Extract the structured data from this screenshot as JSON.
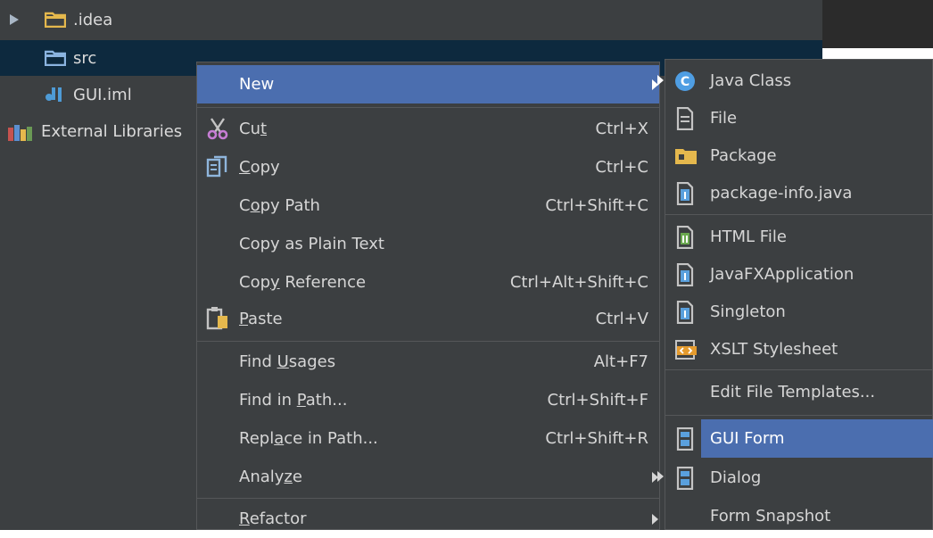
{
  "tree": {
    "items": [
      {
        "label": ".idea",
        "icon": "folder-icon"
      },
      {
        "label": "src",
        "icon": "source-folder-icon"
      },
      {
        "label": "GUI.iml",
        "icon": "iml-file-icon"
      },
      {
        "label": "External Libraries",
        "icon": "libraries-icon"
      }
    ]
  },
  "context_menu": {
    "items": [
      {
        "pre": "",
        "u": "",
        "post": "New",
        "shortcut": ""
      },
      {
        "pre": "Cu",
        "u": "t",
        "post": "",
        "shortcut": "Ctrl+X"
      },
      {
        "pre": "",
        "u": "C",
        "post": "opy",
        "shortcut": "Ctrl+C"
      },
      {
        "pre": "C",
        "u": "o",
        "post": "py Path",
        "shortcut": "Ctrl+Shift+C"
      },
      {
        "pre": "Copy as Plain Text",
        "u": "",
        "post": "",
        "shortcut": ""
      },
      {
        "pre": "Cop",
        "u": "y",
        "post": " Reference",
        "shortcut": "Ctrl+Alt+Shift+C"
      },
      {
        "pre": "",
        "u": "P",
        "post": "aste",
        "shortcut": "Ctrl+V"
      },
      {
        "pre": "Find ",
        "u": "U",
        "post": "sages",
        "shortcut": "Alt+F7"
      },
      {
        "pre": "Find in ",
        "u": "P",
        "post": "ath...",
        "shortcut": "Ctrl+Shift+F"
      },
      {
        "pre": "Repl",
        "u": "a",
        "post": "ce in Path...",
        "shortcut": "Ctrl+Shift+R"
      },
      {
        "pre": "Analy",
        "u": "z",
        "post": "e",
        "shortcut": ""
      },
      {
        "pre": "",
        "u": "R",
        "post": "efactor",
        "shortcut": ""
      }
    ]
  },
  "new_submenu": {
    "items": [
      {
        "label": "Java Class",
        "icon": "java-class-icon"
      },
      {
        "label": "File",
        "icon": "file-icon"
      },
      {
        "label": "Package",
        "icon": "package-icon"
      },
      {
        "label": "package-info.java",
        "icon": "java-file-icon"
      },
      {
        "label": "HTML File",
        "icon": "html-file-icon"
      },
      {
        "label": "JavaFXApplication",
        "icon": "java-file-icon"
      },
      {
        "label": "Singleton",
        "icon": "java-file-icon"
      },
      {
        "label": "XSLT Stylesheet",
        "icon": "xslt-icon"
      },
      {
        "label": "Edit File Templates...",
        "icon": ""
      },
      {
        "label": "GUI Form",
        "icon": "gui-form-icon"
      },
      {
        "label": "Dialog",
        "icon": "dialog-form-icon"
      },
      {
        "label": "Form Snapshot",
        "icon": ""
      }
    ]
  },
  "colors": {
    "menu_background": "#3c3f41",
    "highlight": "#4b6eaf",
    "tree_selection": "#0d293e",
    "separator": "#555759",
    "text": "#d6d6d6"
  }
}
